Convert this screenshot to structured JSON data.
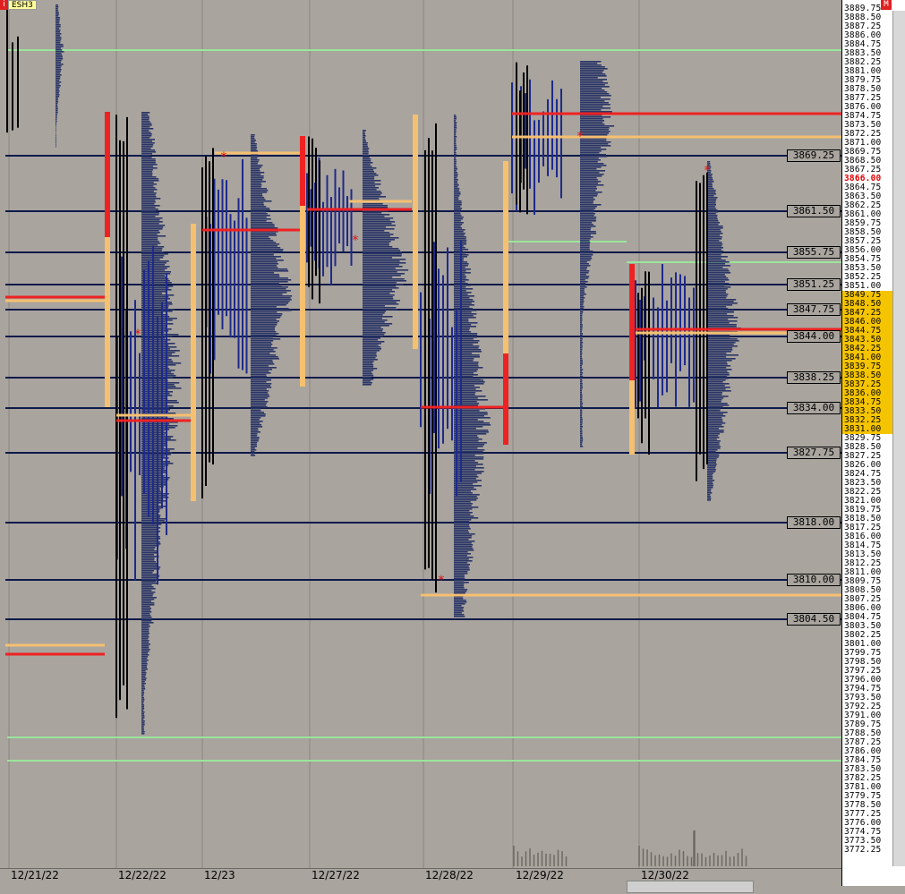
{
  "symbol": {
    "icon_letter": "i",
    "name": "ESH3"
  },
  "badge": "M",
  "current_price": "3866.00",
  "dates": [
    "12/21/22",
    "12/22/22",
    "12/23",
    "12/27/22",
    "12/28/22",
    "12/29/22",
    "12/30/22"
  ],
  "level_labels": [
    "3869.25",
    "3861.50",
    "3855.75",
    "3851.25",
    "3847.75",
    "3844.00",
    "3838.25",
    "3834.00",
    "3827.75",
    "3818.00",
    "3810.00",
    "3804.50"
  ],
  "price_ticks": [
    "3889.75",
    "3888.50",
    "3887.25",
    "3886.00",
    "3884.75",
    "3883.50",
    "3882.25",
    "3881.00",
    "3879.75",
    "3878.50",
    "3877.25",
    "3876.00",
    "3874.75",
    "3873.50",
    "3872.25",
    "3871.00",
    "3869.75",
    "3868.50",
    "3867.25",
    "3866.00",
    "3864.75",
    "3863.50",
    "3862.25",
    "3861.00",
    "3859.75",
    "3858.50",
    "3857.25",
    "3856.00",
    "3854.75",
    "3853.50",
    "3852.25",
    "3851.00",
    "3849.75",
    "3848.50",
    "3847.25",
    "3846.00",
    "3844.75",
    "3843.50",
    "3842.25",
    "3841.00",
    "3839.75",
    "3838.50",
    "3837.25",
    "3836.00",
    "3834.75",
    "3833.50",
    "3832.25",
    "3831.00",
    "3829.75",
    "3828.50",
    "3827.25",
    "3826.00",
    "3824.75",
    "3823.50",
    "3822.25",
    "3821.00",
    "3819.75",
    "3818.50",
    "3817.25",
    "3816.00",
    "3814.75",
    "3813.50",
    "3812.25",
    "3811.00",
    "3809.75",
    "3808.50",
    "3807.25",
    "3806.00",
    "3804.75",
    "3803.50",
    "3802.25",
    "3801.00",
    "3799.75",
    "3798.50",
    "3797.25",
    "3796.00",
    "3794.75",
    "3793.50",
    "3792.25",
    "3791.00",
    "3789.75",
    "3788.50",
    "3787.25",
    "3786.00",
    "3784.75",
    "3783.50",
    "3782.25",
    "3781.00",
    "3779.75",
    "3778.50",
    "3777.25",
    "3776.00",
    "3774.75",
    "3773.50",
    "3772.25"
  ],
  "value_area": {
    "high": "3849.75",
    "low": "3831.00"
  },
  "colors": {
    "level_line": "#0d1a4a",
    "poc": "#ee2222",
    "vwap": "#f5c070",
    "green_line": "#9ae69a",
    "tpo_blue": "#1e2a8c",
    "profile_fill": "#2a3566",
    "black": "#000000",
    "va_yellow": "#f5c400"
  },
  "icons": {
    "scroll": "scrollbar",
    "single_print": "asterisk-icon"
  }
}
